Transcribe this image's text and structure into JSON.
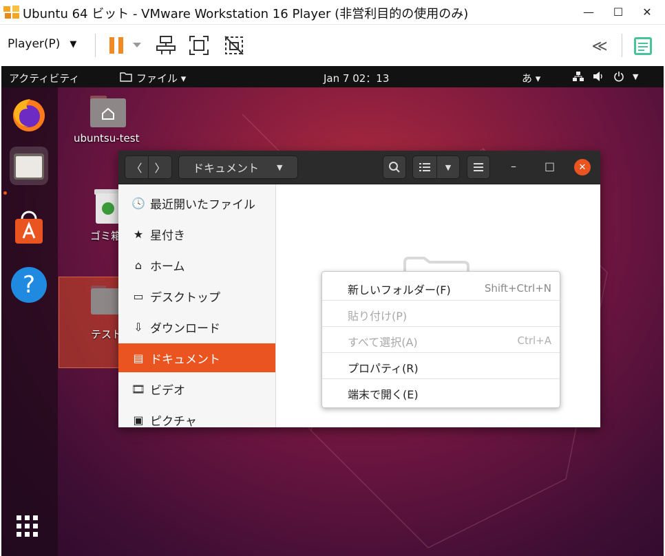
{
  "window": {
    "title": "Ubuntu 64 ビット - VMware Workstation 16 Player (非営利目的の使用のみ)",
    "minimize_glyph": "—",
    "maximize_glyph": "☐",
    "close_glyph": "✕"
  },
  "toolbar": {
    "player_label": "Player(P)",
    "player_arrow": "▼"
  },
  "topbar": {
    "activities": "アクティビティ",
    "files_menu": "ファイル ▾",
    "clock": "Jan 7  02：13",
    "input_method": "あ ▾"
  },
  "dock": {
    "apps_grid_glyph": "⠿",
    "help_glyph": "?"
  },
  "desktop": {
    "icons": [
      {
        "label": "ubuntsu-test"
      },
      {
        "label": "ゴミ箱"
      },
      {
        "label": "テスト"
      }
    ]
  },
  "nautilus": {
    "back_glyph": "〈",
    "forward_glyph": "〉",
    "path_label": "ドキュメント",
    "path_arrow": "▼",
    "view_arrow": "▼",
    "min_glyph": "–",
    "max_glyph": "□",
    "close_glyph": "✕",
    "sidebar": [
      {
        "label": "最近開いたファイル",
        "icon": "clock-icon",
        "glyph": "🕓"
      },
      {
        "label": "星付き",
        "icon": "star-icon",
        "glyph": "★"
      },
      {
        "label": "ホーム",
        "icon": "home-icon",
        "glyph": "⌂"
      },
      {
        "label": "デスクトップ",
        "icon": "desktop-icon",
        "glyph": "▭"
      },
      {
        "label": "ダウンロード",
        "icon": "download-icon",
        "glyph": "⇩"
      },
      {
        "label": "ドキュメント",
        "icon": "document-icon",
        "glyph": "▤"
      },
      {
        "label": "ビデオ",
        "icon": "video-icon",
        "glyph": "🎞"
      },
      {
        "label": "ピクチャ",
        "icon": "picture-icon",
        "glyph": "▣"
      }
    ]
  },
  "context_menu": [
    {
      "label": "新しいフォルダー(F)",
      "shortcut": "Shift+Ctrl+N",
      "enabled": true
    },
    {
      "label": "貼り付け(P)",
      "shortcut": "",
      "enabled": false
    },
    {
      "label": "すべて選択(A)",
      "shortcut": "Ctrl+A",
      "enabled": false
    },
    {
      "label": "プロパティ(R)",
      "shortcut": "",
      "enabled": true
    },
    {
      "label": "端末で開く(E)",
      "shortcut": "",
      "enabled": true
    }
  ],
  "colors": {
    "accent": "#e95420",
    "pause": "#f08a24"
  }
}
